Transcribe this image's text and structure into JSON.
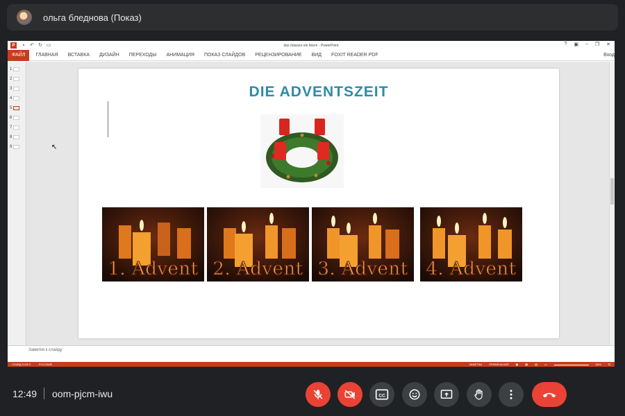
{
  "meet": {
    "presenter_name": "ольга бледнова (Показ)",
    "clock": "12:49",
    "meeting_code": "oom-pjcm-iwu",
    "controls": [
      "microphone-off",
      "camera-off",
      "captions",
      "emoji",
      "present",
      "raise-hand",
      "more-options",
      "leave-call"
    ],
    "captions_label": "CC"
  },
  "powerpoint": {
    "window_title": "das mässen ein feiern - PowerPoint",
    "file_tab": "ФАЙЛ",
    "ribbon_tabs": [
      "ГЛАВНАЯ",
      "ВСТАВКА",
      "ДИЗАЙН",
      "ПЕРЕХОДЫ",
      "АНИМАЦИЯ",
      "ПОКАЗ СЛАЙДОВ",
      "РЕЦЕНЗИРОВАНИЕ",
      "ВИД",
      "FOXIT READER PDF"
    ],
    "login": "Вход",
    "thumbnail_numbers": [
      "1",
      "2",
      "3",
      "4",
      "5",
      "6",
      "7",
      "8",
      "9"
    ],
    "active_slide": "5",
    "notes_placeholder": "Заметки к слайду",
    "status_left": "СЛАЙД 5 ИЗ 9",
    "status_lang": "РУССКИЙ",
    "status_notes": "ЗАМЕТКИ",
    "status_comments": "ПРИМЕЧАНИЯ",
    "zoom": "54%",
    "accent_color": "#c43e1c"
  },
  "slide": {
    "title": "DIE ADVENTSZEIT",
    "title_color": "#2e8ba6",
    "advent_labels": [
      "1. Advent",
      "2. Advent",
      "3. Advent",
      "4. Advent"
    ]
  }
}
